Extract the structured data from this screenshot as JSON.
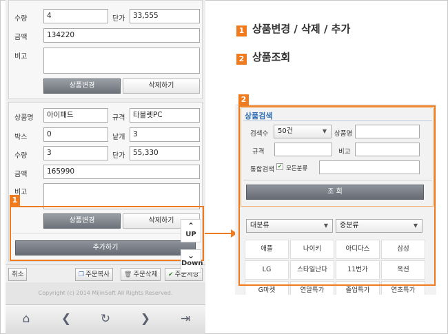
{
  "legend": [
    {
      "num": "1",
      "text": "상품변경 / 삭제 / 추가"
    },
    {
      "num": "2",
      "text": "상품조회"
    }
  ],
  "phone": {
    "card1": {
      "qty_label": "수량",
      "qty_value": "4",
      "price_label": "단가",
      "price_value": "33,555",
      "amount_label": "금액",
      "amount_value": "134220",
      "note_label": "비고",
      "change_button": "상품변경",
      "delete_button": "삭제하기"
    },
    "card2": {
      "name_label": "상품명",
      "name_value": "아이패드",
      "spec_label": "규격",
      "spec_value": "타블렛PC",
      "box_label": "박스",
      "box_value": "0",
      "unit_label": "낱개",
      "unit_value": "3",
      "qty_label": "수량",
      "qty_value": "3",
      "price_label": "단가",
      "price_value": "55,330",
      "amount_label": "금액",
      "amount_value": "165990",
      "note_label": "비고",
      "change_button": "상품변경",
      "delete_button": "삭제하기"
    },
    "add_button": "추가하기",
    "up_label": "UP",
    "down_label": "Down",
    "bottom_bar": {
      "cancel": "취소",
      "copy": "주문복사",
      "delete": "주문삭제",
      "save": "주문저장"
    },
    "copyright": "Copyright (c) 2014 MijinSoft All Rights Reserved.",
    "nav_icons": [
      "home-icon",
      "back-icon",
      "refresh-icon",
      "forward-icon",
      "exit-icon"
    ]
  },
  "search": {
    "title": "상품검색",
    "count_label": "검색수",
    "count_value": "50건",
    "name_label": "상품명",
    "name_value": "",
    "spec_label": "규격",
    "spec_value": "",
    "note_label": "비고",
    "note_value": "",
    "integrated_label": "통합검색",
    "all_category_label": "모든분류",
    "all_category_checked": true,
    "integrated_value": "",
    "search_button": "조 회",
    "major_category": "대분류",
    "middle_category": "중분류",
    "brands": [
      "애플",
      "나이키",
      "아디다스",
      "삼성",
      "LG",
      "스타일난다",
      "11번가",
      "옥션",
      "G마켓",
      "연말특가",
      "졸업특가",
      "연초특가"
    ]
  },
  "colors": {
    "accent": "#f07b1e",
    "title_blue": "#2f6db5"
  }
}
